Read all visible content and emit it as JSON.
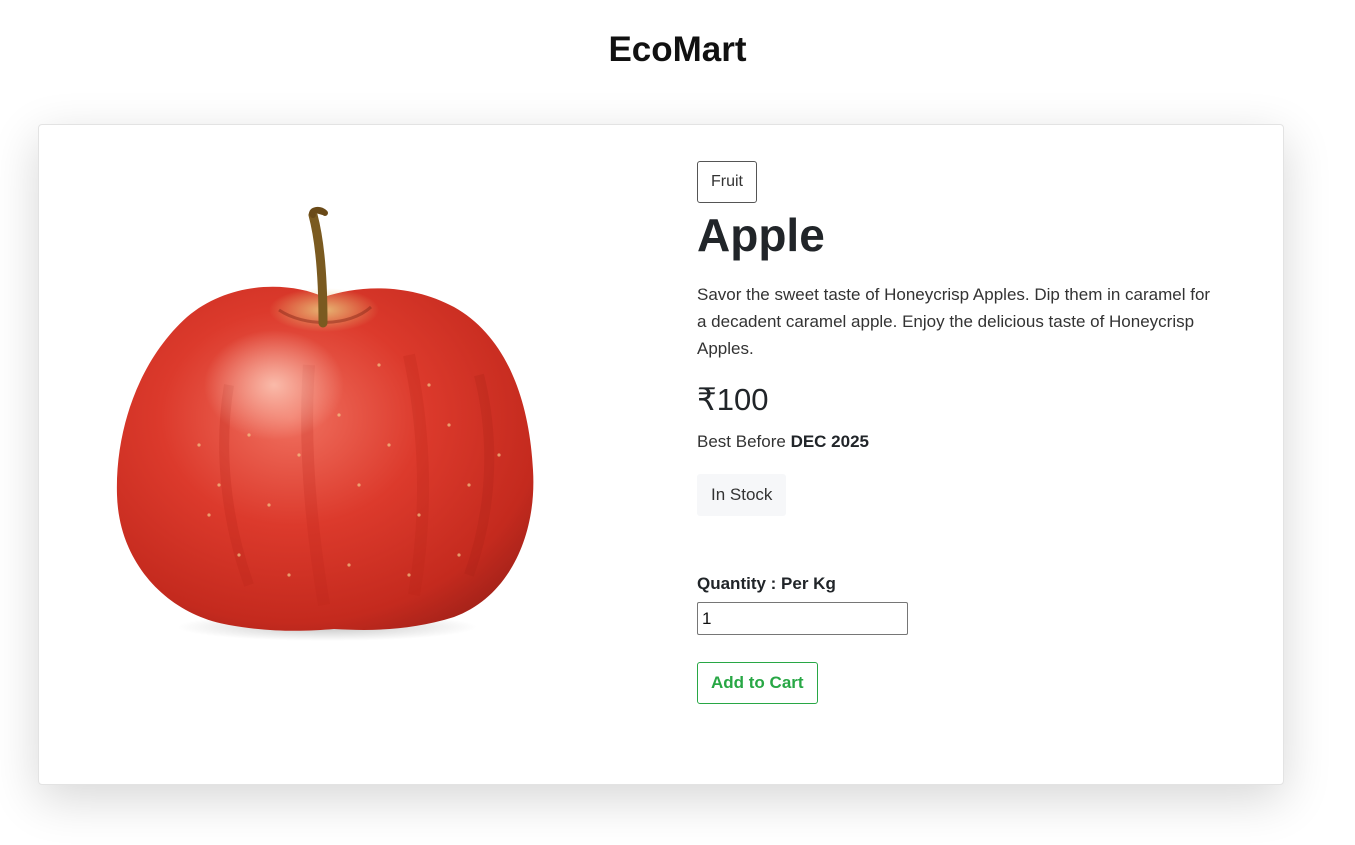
{
  "header": {
    "title": "EcoMart"
  },
  "product": {
    "category": "Fruit",
    "name": "Apple",
    "description": "Savor the sweet taste of Honeycrisp Apples. Dip them in caramel for a decadent caramel apple. Enjoy the delicious taste of Honeycrisp Apples.",
    "price": "₹100",
    "best_before_label": "Best Before",
    "best_before_value": "DEC 2025",
    "stock_status": "In Stock",
    "image_icon": "apple-image"
  },
  "purchase": {
    "quantity_label": "Quantity : Per Kg",
    "quantity_value": "1",
    "add_to_cart_label": "Add to Cart"
  },
  "colors": {
    "accent_green": "#28a745",
    "apple_red": "#d8302a"
  }
}
